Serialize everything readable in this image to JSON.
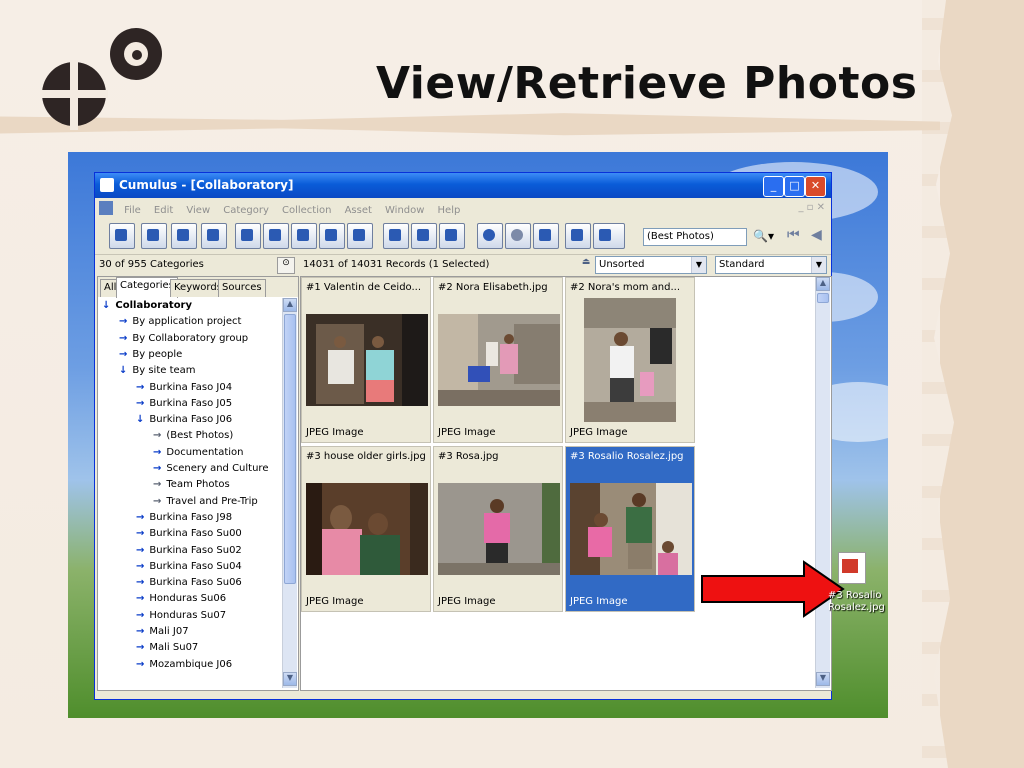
{
  "slide": {
    "title": "View/Retrieve Photos"
  },
  "window": {
    "title": "Cumulus - [Collaboratory]"
  },
  "menu": [
    "File",
    "Edit",
    "View",
    "Category",
    "Collection",
    "Asset",
    "Window",
    "Help"
  ],
  "toolbar": {
    "search_combo": "(Best Photos)"
  },
  "left_status": "30 of 955 Categories",
  "records_status": "14031 of 14031 Records (1 Selected)",
  "sort_combo": "Unsorted",
  "view_combo": "Standard",
  "tabs": [
    "All",
    "Categories",
    "Keywords",
    "Sources"
  ],
  "tree": [
    {
      "label": "Collaboratory",
      "level": 0,
      "bold": true
    },
    {
      "label": "By application project",
      "level": 1
    },
    {
      "label": "By Collaboratory group",
      "level": 1
    },
    {
      "label": "By people",
      "level": 1
    },
    {
      "label": "By site team",
      "level": 1
    },
    {
      "label": "Burkina Faso J04",
      "level": 2
    },
    {
      "label": "Burkina Faso J05",
      "level": 2
    },
    {
      "label": "Burkina Faso J06",
      "level": 2
    },
    {
      "label": "(Best Photos)",
      "level": 3,
      "gray": true
    },
    {
      "label": "Documentation",
      "level": 3
    },
    {
      "label": "Scenery and Culture",
      "level": 3
    },
    {
      "label": "Team Photos",
      "level": 3,
      "gray": true
    },
    {
      "label": "Travel and Pre-Trip",
      "level": 3,
      "gray": true
    },
    {
      "label": "Burkina Faso J98",
      "level": 2
    },
    {
      "label": "Burkina Faso Su00",
      "level": 2
    },
    {
      "label": "Burkina Faso Su02",
      "level": 2
    },
    {
      "label": "Burkina Faso Su04",
      "level": 2
    },
    {
      "label": "Burkina Faso Su06",
      "level": 2
    },
    {
      "label": "Honduras Su06",
      "level": 2
    },
    {
      "label": "Honduras Su07",
      "level": 2
    },
    {
      "label": "Mali J07",
      "level": 2
    },
    {
      "label": "Mali Su07",
      "level": 2
    },
    {
      "label": "Mozambique J06",
      "level": 2
    }
  ],
  "records": [
    {
      "name": "#1 Valentin de Ceido...",
      "kind": "JPEG Image"
    },
    {
      "name": "#2 Nora Elisabeth.jpg",
      "kind": "JPEG Image"
    },
    {
      "name": "#2 Nora's mom and...",
      "kind": "JPEG Image"
    },
    {
      "name": "#3 house older girls.jpg",
      "kind": "JPEG Image"
    },
    {
      "name": "#3 Rosa.jpg",
      "kind": "JPEG Image"
    },
    {
      "name": "#3 Rosalio Rosalez.jpg",
      "kind": "JPEG Image",
      "selected": true
    }
  ],
  "desktop_icon": {
    "label_line1": "#3 Rosalio",
    "label_line2": "Rosalez.jpg"
  },
  "colors": {
    "titlebar": "#0a5cd8",
    "selection": "#316ac5",
    "arrow": "#ee1111"
  }
}
